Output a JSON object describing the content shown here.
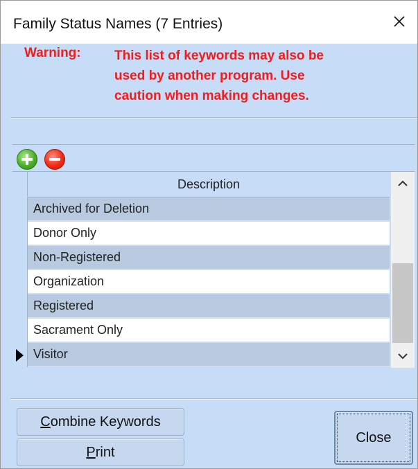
{
  "window": {
    "title": "Family Status Names (7 Entries)",
    "close_icon": "close-x"
  },
  "warning": {
    "label": "Warning:",
    "text": "This list of keywords may also be\nused by another program. Use\ncaution when making changes."
  },
  "toolbar": {
    "add_icon": "green-plus-circle",
    "remove_icon": "red-minus-circle"
  },
  "grid": {
    "column_header": "Description",
    "rows": [
      {
        "description": "Archived for Deletion",
        "current": false
      },
      {
        "description": "Donor Only",
        "current": false
      },
      {
        "description": "Non-Registered",
        "current": false
      },
      {
        "description": "Organization",
        "current": false
      },
      {
        "description": "Registered",
        "current": false
      },
      {
        "description": "Sacrament Only",
        "current": false
      },
      {
        "description": "Visitor",
        "current": true
      }
    ],
    "scroll_up_icon": "chevron-up",
    "scroll_down_icon": "chevron-down"
  },
  "buttons": {
    "combine_mnemonic": "C",
    "combine_rest": "ombine Keywords",
    "print_mnemonic": "P",
    "print_rest": "rint",
    "close": "Close"
  },
  "colors": {
    "panel_background": "#c7dcf7",
    "warning_text": "#ef1d1d",
    "shaded_row": "#b7cadf",
    "plain_row": "#ffffff"
  }
}
